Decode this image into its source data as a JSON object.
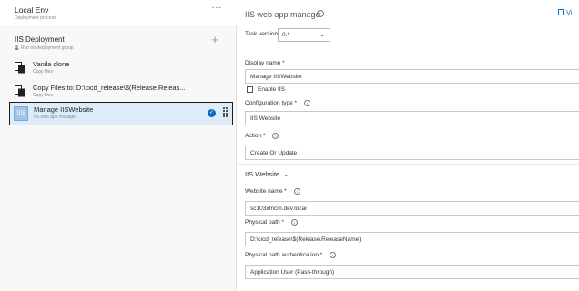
{
  "environment": {
    "title": "Local Env",
    "subtitle": "Deployment process",
    "more_label": "···"
  },
  "phase": {
    "title": "IIS Deployment",
    "subtitle": "Run on deployment group",
    "add_label": "+"
  },
  "tasks": [
    {
      "name": "Vanila clone",
      "subtitle": "Copy files",
      "icon": "copy-files-icon"
    },
    {
      "name": "Copy Files to: D:\\cicd_release\\$(Release.Releas...",
      "subtitle": "Copy files",
      "icon": "copy-files-icon"
    },
    {
      "name": "Manage IISWebsite",
      "subtitle": "IIS web app manage",
      "icon": "iis-icon",
      "icon_text": "IIS",
      "selected": true
    }
  ],
  "panel": {
    "title": "IIS web app manage",
    "view_label": "Vi",
    "task_version_label": "Task version",
    "task_version_value": "0.*",
    "display_name_label": "Display name *",
    "display_name_value": "Manage IISWebsite",
    "enable_iis_label": "Enable IIS",
    "enable_iis_checked": false,
    "configuration_type_label": "Configuration type *",
    "configuration_type_value": "IIS Website",
    "action_label": "Action *",
    "action_value": "Create Or Update",
    "section_title": "IIS Website",
    "website_name_label": "Website name *",
    "website_name_value": "sc103xmcm.dev.local",
    "physical_path_label": "Physical path *",
    "physical_path_value": "D:\\cicd_release\\$(Release.ReleaseName)",
    "physical_path_auth_label": "Physical path authentication *",
    "physical_path_auth_value": "Application User (Pass-through)"
  },
  "colors": {
    "accent": "#0a6cc4",
    "selected_bg": "#deecf9",
    "link": "#1b6ec2"
  }
}
